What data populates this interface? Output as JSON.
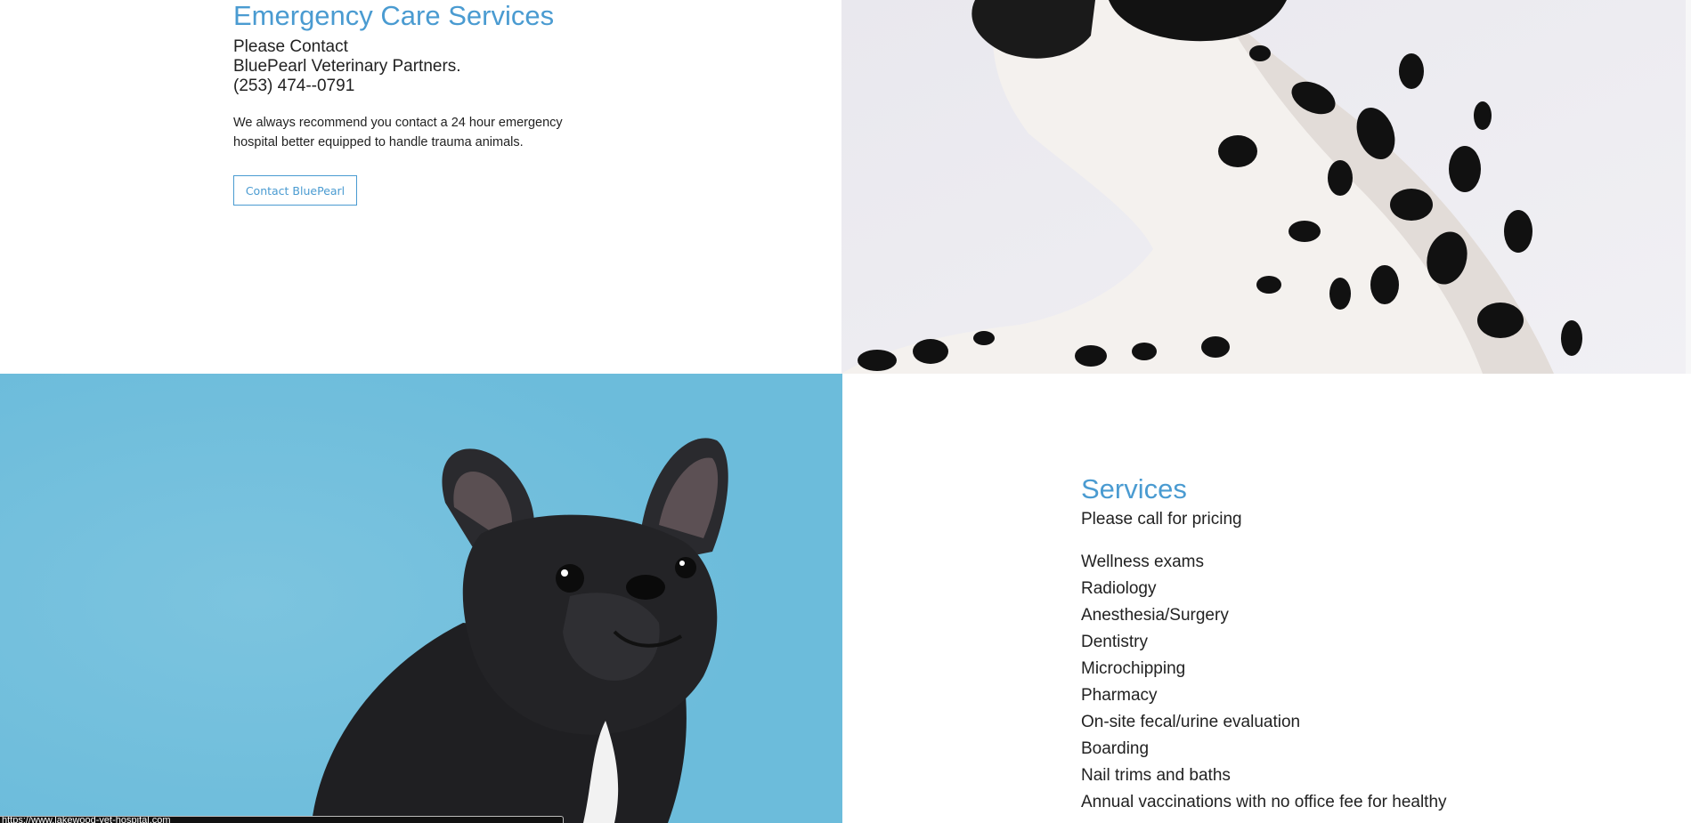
{
  "emergency": {
    "title": "Emergency Care Services",
    "contact_lines": [
      "Please Contact",
      "BluePearl Veterinary Partners.",
      "(253) 474--0791"
    ],
    "note": "We always recommend you contact a 24 hour emergency hospital better equipped to handle trauma animals.",
    "button_label": "Contact BluePearl"
  },
  "services": {
    "title": "Services",
    "subtitle": "Please call for pricing",
    "items": [
      "Wellness exams",
      "Radiology",
      "Anesthesia/Surgery",
      "Dentistry",
      "Microchipping",
      "Pharmacy",
      "On-site fecal/urine evaluation",
      "Boarding",
      "Nail trims and baths",
      "Annual vaccinations with no office fee for healthy"
    ]
  },
  "status_bar": {
    "url": "https://www.lakewood-vet-hospital.com"
  },
  "colors": {
    "accent": "#4a9bd1",
    "photo_background_blue": "#6cbcdb",
    "text": "#222222"
  }
}
